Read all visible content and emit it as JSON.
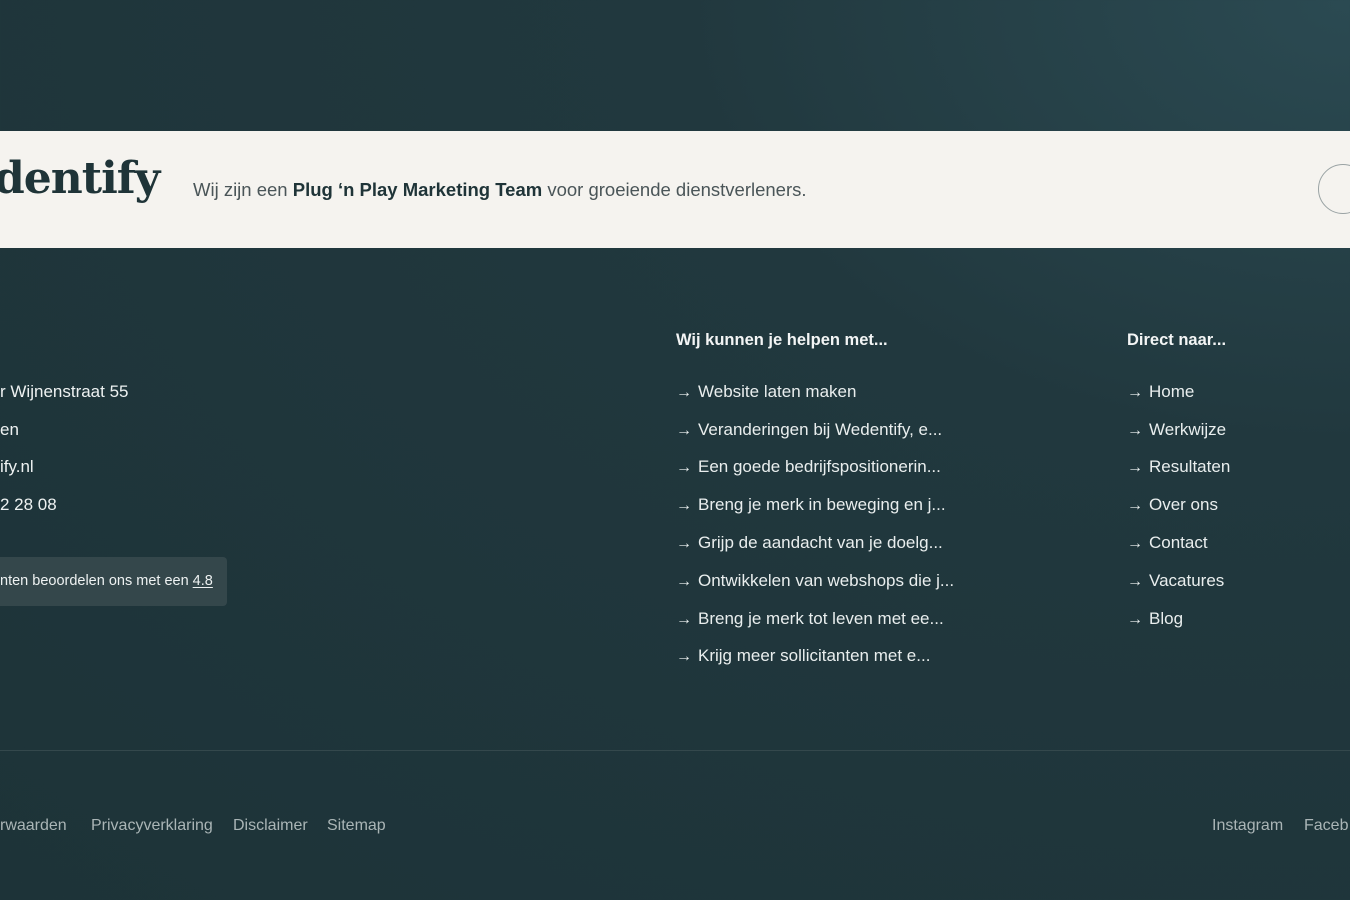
{
  "banner": {
    "logo_text": "dentify",
    "tagline_pre": "Wij zijn een ",
    "tagline_bold": "Plug ‘n Play Marketing Team",
    "tagline_post": " voor groeiende dienstverleners."
  },
  "contact": {
    "lines": [
      "r Wijnenstraat 55",
      "en",
      "ify.nl",
      "2 28 08"
    ],
    "rating_text": "nten beoordelen ons met een ",
    "rating_value": "4.8"
  },
  "help": {
    "title": "Wij kunnen je helpen met...",
    "arrow": "→",
    "items": [
      "Website laten maken",
      "Veranderingen bij Wedentify, e...",
      "Een goede bedrijfspositionerin...",
      "Breng je merk in beweging en j...",
      "Grijp de aandacht van je doelg...",
      "Ontwikkelen van webshops die j...",
      "Breng je merk tot leven met ee...",
      "Krijg meer sollicitanten met e..."
    ]
  },
  "direct": {
    "title": "Direct naar...",
    "arrow": "→",
    "items": [
      "Home",
      "Werkwijze",
      "Resultaten",
      "Over ons",
      "Contact",
      "Vacatures",
      "Blog"
    ]
  },
  "bottom": {
    "legal": [
      "rwaarden",
      "Privacyverklaring",
      "Disclaimer",
      "Sitemap"
    ],
    "social": [
      "Instagram",
      "Faceb"
    ]
  }
}
